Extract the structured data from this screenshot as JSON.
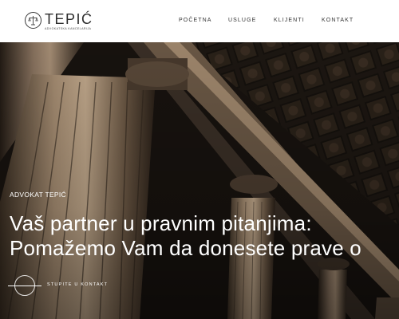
{
  "header": {
    "logo_name": "TEPIĆ",
    "logo_tagline": "ADVOKATSKA KANCELARIJA"
  },
  "nav": {
    "items": [
      {
        "label": "POČETNA"
      },
      {
        "label": "USLUGE"
      },
      {
        "label": "KLIJENTI"
      },
      {
        "label": "KONTAKT"
      }
    ]
  },
  "hero": {
    "kicker": "ADVOKAT TEPIĆ",
    "headline_line1": "Vaš partner u pravnim pitanjima:",
    "headline_line2": "Pomažemo Vam da donesete prave o",
    "cta_label": "STUPITE U KONTAKT",
    "background_image": "courthouse-columns-photo"
  },
  "colors": {
    "header_bg": "#ffffff",
    "nav_text": "#333333",
    "hero_text": "#ffffff",
    "hero_bg_dark": "#1c1712",
    "stone": "#a88f74"
  }
}
